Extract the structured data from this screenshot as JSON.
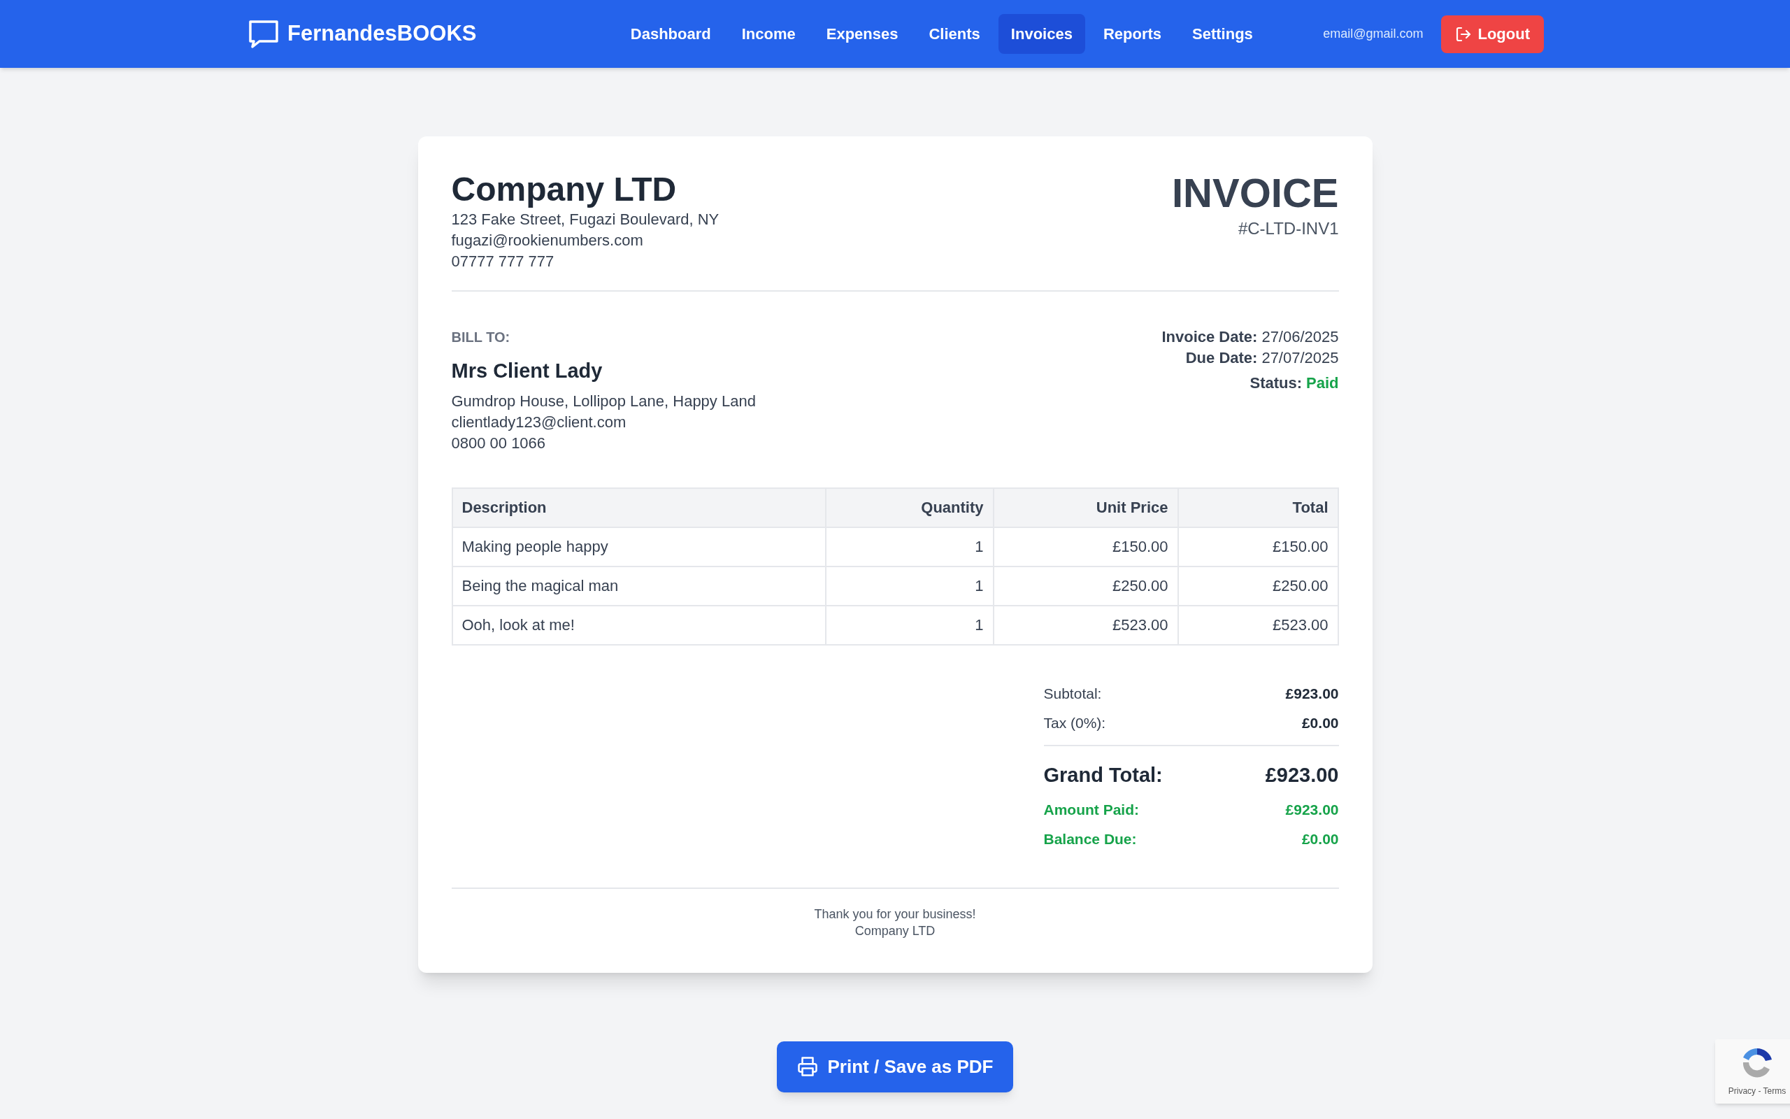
{
  "header": {
    "brand": "FernandesBOOKS",
    "nav": [
      {
        "label": "Dashboard",
        "selected": false
      },
      {
        "label": "Income",
        "selected": false
      },
      {
        "label": "Expenses",
        "selected": false
      },
      {
        "label": "Clients",
        "selected": false
      },
      {
        "label": "Invoices",
        "selected": true
      },
      {
        "label": "Reports",
        "selected": false
      },
      {
        "label": "Settings",
        "selected": false
      }
    ],
    "email": "email@gmail.com",
    "logout": "Logout"
  },
  "invoice": {
    "company": {
      "name": "Company LTD",
      "lines": [
        "123 Fake Street, Fugazi Boulevard, NY",
        "fugazi@rookienumbers.com",
        "07777 777 777"
      ]
    },
    "title": "INVOICE",
    "number": "#C-LTD-INV1",
    "bill_to": {
      "label": "BILL TO:",
      "name": "Mrs Client Lady",
      "lines": [
        "Gumdrop House, Lollipop Lane, Happy Land",
        "clientlady123@client.com",
        "0800 00 1066"
      ]
    },
    "meta": [
      {
        "label": "Invoice Date:",
        "value": "27/06/2025",
        "kind": "plain"
      },
      {
        "label": "Due Date:",
        "value": "27/07/2025",
        "kind": "plain"
      },
      {
        "label": "Status:",
        "value": "Paid",
        "kind": "status"
      }
    ],
    "table": {
      "columns": [
        "Description",
        "Quantity",
        "Unit Price",
        "Total"
      ],
      "rows": [
        [
          "Making people happy",
          "1",
          "£150.00",
          "£150.00"
        ],
        [
          "Being the magical man",
          "1",
          "£250.00",
          "£250.00"
        ],
        [
          "Ooh, look at me!",
          "1",
          "£523.00",
          "£523.00"
        ]
      ]
    },
    "totals": [
      {
        "label": "Subtotal:",
        "value": "£923.00",
        "kind": "normal"
      },
      {
        "label": "Tax (0%):",
        "value": "£0.00",
        "kind": "normal"
      },
      {
        "label": "Grand Total:",
        "value": "£923.00",
        "kind": "grand"
      },
      {
        "label": "Amount Paid:",
        "value": "£923.00",
        "kind": "paid"
      },
      {
        "label": "Balance Due:",
        "value": "£0.00",
        "kind": "paid"
      }
    ],
    "footer": [
      "Thank you for your business!",
      "Company LTD"
    ]
  },
  "print_button": "Print / Save as PDF",
  "recaptcha": {
    "links": "Privacy - Terms"
  }
}
